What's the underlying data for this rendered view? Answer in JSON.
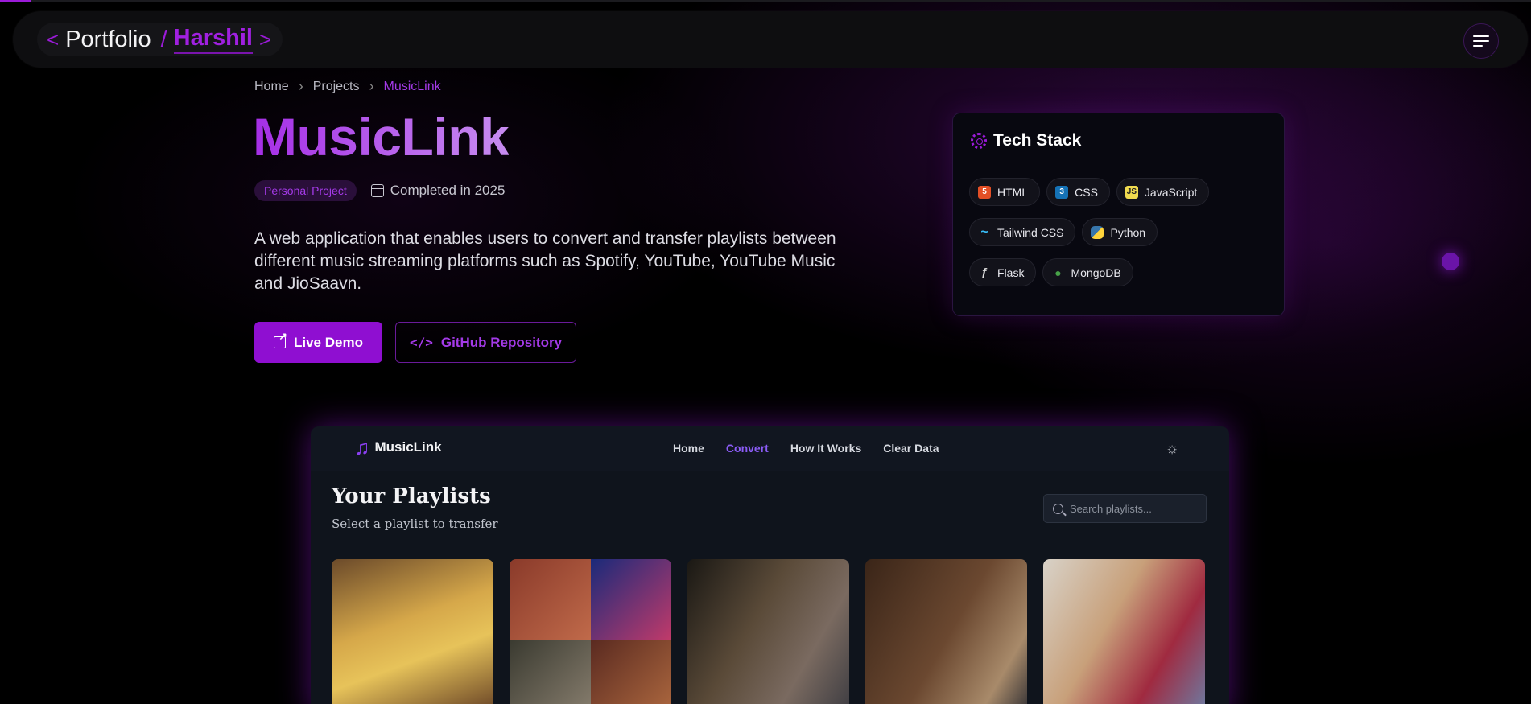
{
  "colors": {
    "accent": "#9b1bd8",
    "background": "#000000",
    "preview_accent": "#8b5cf6"
  },
  "navbar": {
    "brand_left_angle": "<",
    "brand_word": "Portfolio",
    "brand_slash": "/",
    "brand_name": "Harshil",
    "brand_right_angle": ">",
    "menu_icon": "hamburger-icon"
  },
  "breadcrumb": {
    "items": [
      "Home",
      "Projects",
      "MusicLink"
    ],
    "separator": "›"
  },
  "project": {
    "title": "MusicLink",
    "badge": "Personal Project",
    "completed": "Completed in 2025",
    "description": "A web application that enables users to convert and transfer playlists between different music streaming platforms such as Spotify, YouTube, YouTube Music and JioSaavn.",
    "live_demo_label": "Live Demo",
    "github_label": "GitHub Repository"
  },
  "tech_stack": {
    "title": "Tech Stack",
    "items": [
      {
        "label": "HTML",
        "icon": "html5-icon",
        "color": "#e34f26",
        "glyph": "5"
      },
      {
        "label": "CSS",
        "icon": "css3-icon",
        "color": "#1572b6",
        "glyph": "3"
      },
      {
        "label": "JavaScript",
        "icon": "javascript-icon",
        "color": "#f0db4f",
        "glyph": "JS"
      },
      {
        "label": "Tailwind CSS",
        "icon": "tailwind-icon",
        "color": "#38bdf8",
        "glyph": "~"
      },
      {
        "label": "Python",
        "icon": "python-icon",
        "color": "#3776ab",
        "glyph": "py"
      },
      {
        "label": "Flask",
        "icon": "flask-icon",
        "color": "#2a2a2a",
        "glyph": "ƒ"
      },
      {
        "label": "MongoDB",
        "icon": "mongodb-icon",
        "color": "#47a248",
        "glyph": "●"
      }
    ]
  },
  "preview": {
    "logo": "MusicLink",
    "logo_icon": "music-note-icon",
    "nav_links": [
      "Home",
      "Convert",
      "How It Works",
      "Clear Data"
    ],
    "active_link": "Convert",
    "theme_icon": "sun-icon",
    "heading": "Your Playlists",
    "subheading": "Select a playlist to transfer",
    "search_placeholder": "Search playlists...",
    "playlist_covers": [
      "playlist-cover-1",
      "playlist-cover-2",
      "playlist-cover-3",
      "playlist-cover-4",
      "playlist-cover-5"
    ]
  }
}
